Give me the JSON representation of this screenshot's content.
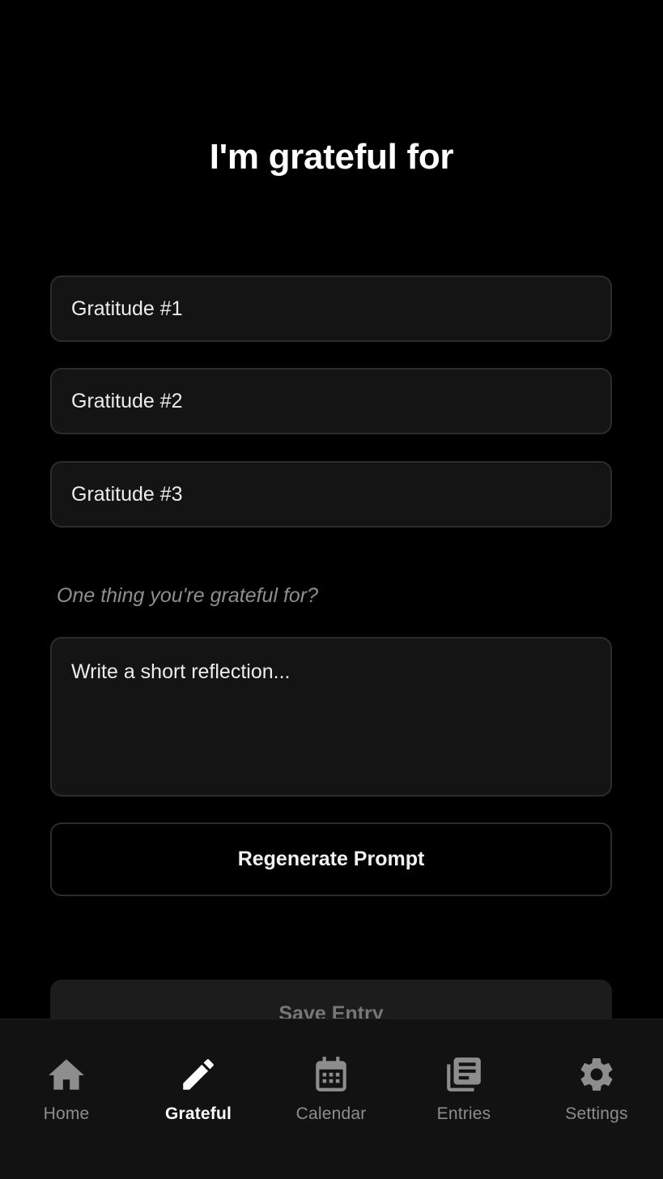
{
  "page": {
    "title": "I'm grateful for"
  },
  "gratitude_inputs": [
    {
      "placeholder": "Gratitude #1",
      "value": ""
    },
    {
      "placeholder": "Gratitude #2",
      "value": ""
    },
    {
      "placeholder": "Gratitude #3",
      "value": ""
    }
  ],
  "prompt": {
    "text": "One thing you're grateful for?"
  },
  "reflection": {
    "placeholder": "Write a short reflection...",
    "value": ""
  },
  "buttons": {
    "regenerate_label": "Regenerate Prompt",
    "save_label": "Save Entry"
  },
  "tab_bar": {
    "active": "Grateful",
    "items": [
      {
        "label": "Home",
        "icon": "home-icon"
      },
      {
        "label": "Grateful",
        "icon": "pencil-icon"
      },
      {
        "label": "Calendar",
        "icon": "calendar-icon"
      },
      {
        "label": "Entries",
        "icon": "entries-icon"
      },
      {
        "label": "Settings",
        "icon": "gear-icon"
      }
    ]
  },
  "colors": {
    "background": "#000000",
    "surface": "#141414",
    "border": "#2c2c2c",
    "tab_bar": "#121212",
    "active": "#ffffff",
    "inactive": "#8d8d8d",
    "muted_prompt": "#8e8e8e"
  }
}
